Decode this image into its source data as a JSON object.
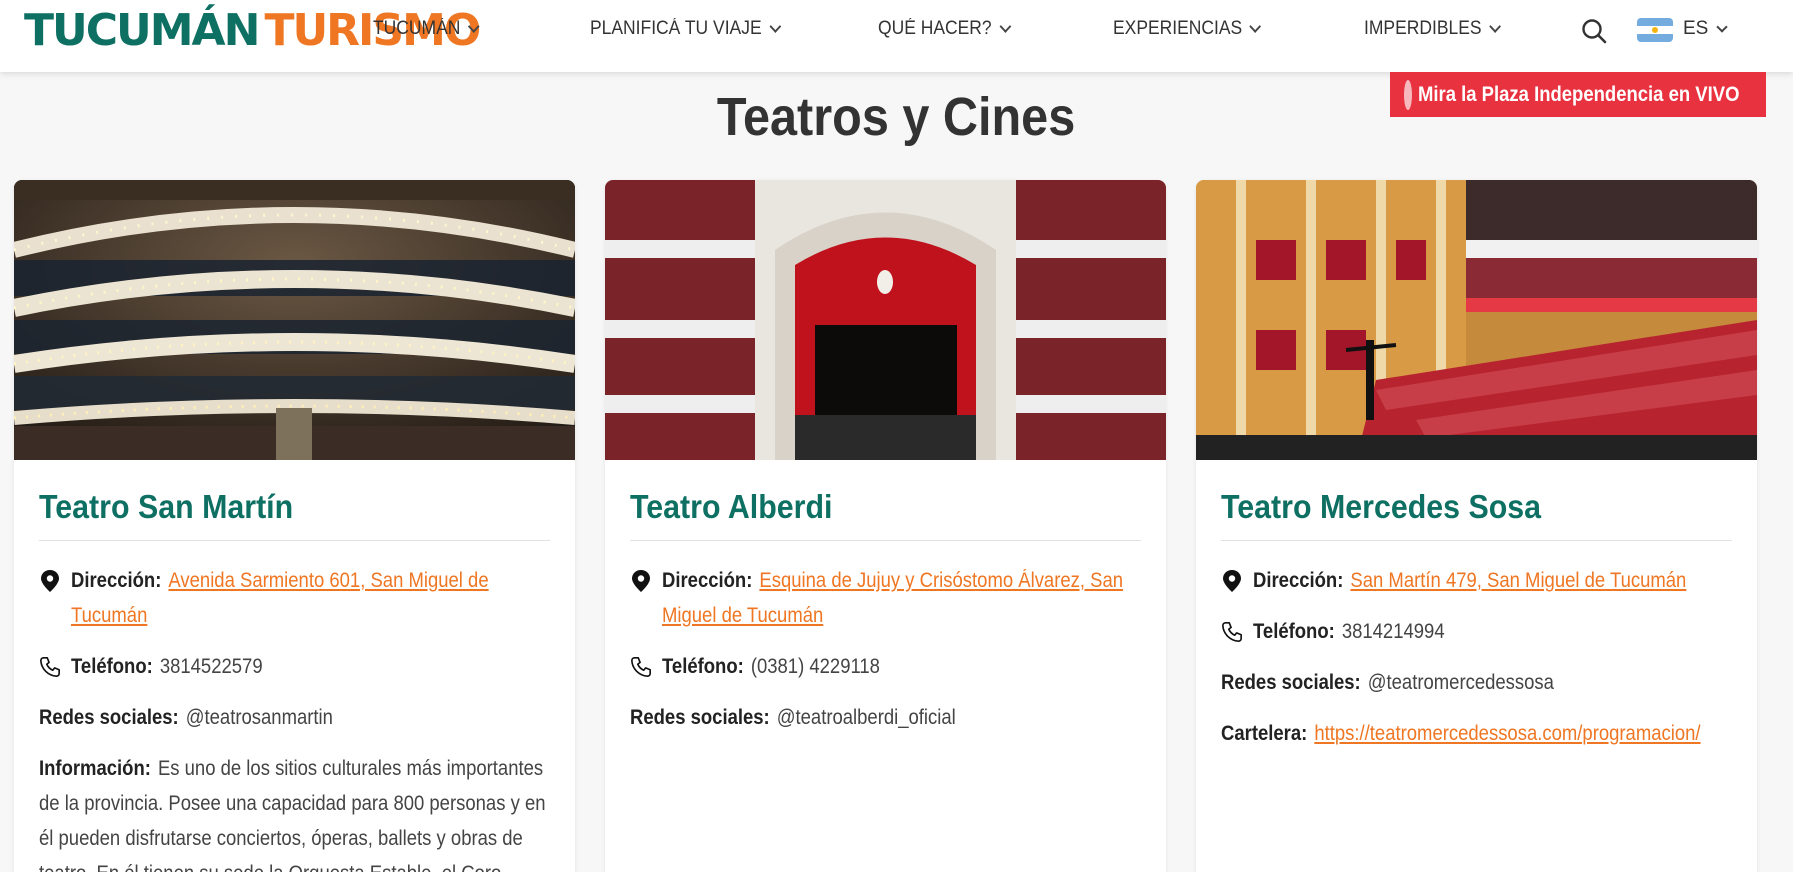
{
  "header": {
    "logo_part1": "TUCUMÁN",
    "logo_part2": "TURISMO",
    "nav": [
      {
        "label": "TUCUMÁN"
      },
      {
        "label": "PLANIFICÁ TU VIAJE"
      },
      {
        "label": "QUÉ HACER?"
      },
      {
        "label": "EXPERIENCIAS"
      },
      {
        "label": "IMPERDIBLES"
      }
    ],
    "search_icon": "search-icon",
    "language": "ES",
    "flag_icon": "argentina-flag-icon"
  },
  "live_banner": {
    "label": "Mira la Plaza Independencia en VIVO",
    "color": "#e9323f"
  },
  "page_title": "Teatros y Cines",
  "colors": {
    "brand_green": "#0e6f63",
    "brand_orange": "#ef7622"
  },
  "cards": [
    {
      "title": "Teatro San Martín",
      "photo": "teatro-san-martin-photo",
      "direccion_label": "Dirección:",
      "direccion": "Avenida Sarmiento 601, San Miguel de Tucumán",
      "telefono_label": "Teléfono:",
      "telefono": "3814522579",
      "redes_label": "Redes sociales:",
      "redes": "@teatrosanmartin",
      "info_label": "Información:",
      "info": "Es uno de los sitios culturales más importantes de la provincia. Posee una capacidad para 800 personas y en él pueden disfrutarse conciertos, óperas, ballets y obras de teatro. En él tienen su sede la Orquesta Estable, el Coro"
    },
    {
      "title": "Teatro Alberdi",
      "photo": "teatro-alberdi-photo",
      "direccion_label": "Dirección:",
      "direccion": "Esquina de Jujuy y Crisóstomo Álvarez, San Miguel de Tucumán",
      "telefono_label": "Teléfono:",
      "telefono": "(0381) 4229118",
      "redes_label": "Redes sociales:",
      "redes": "@teatroalberdi_oficial"
    },
    {
      "title": "Teatro Mercedes Sosa",
      "photo": "teatro-mercedes-sosa-photo",
      "direccion_label": "Dirección:",
      "direccion": "San Martín 479, San Miguel de Tucumán",
      "telefono_label": "Teléfono:",
      "telefono": "3814214994",
      "redes_label": "Redes sociales:",
      "redes": "@teatromercedessosa",
      "cartelera_label": "Cartelera:",
      "cartelera": "https://teatromercedessosa.com/programacion/"
    }
  ]
}
